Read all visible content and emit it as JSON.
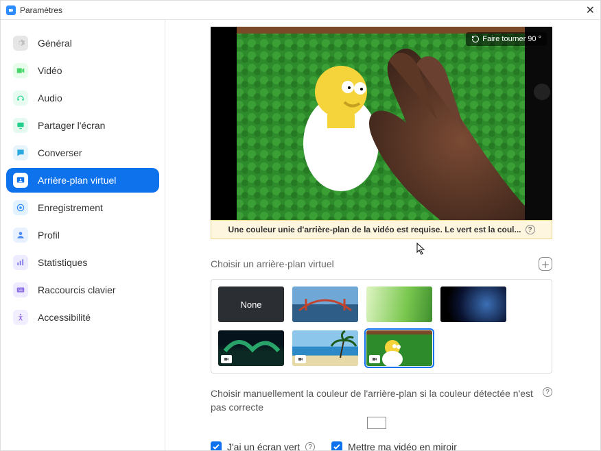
{
  "window": {
    "title": "Paramètres"
  },
  "sidebar": {
    "items": [
      {
        "label": "Général",
        "icon": "gear-icon",
        "bg": "#E6E6E6",
        "fg": "#bfbfbf"
      },
      {
        "label": "Vidéo",
        "icon": "camera-icon",
        "bg": "#E8FCEB",
        "fg": "#47D66A"
      },
      {
        "label": "Audio",
        "icon": "headphones-icon",
        "bg": "#E7FBF1",
        "fg": "#24D390"
      },
      {
        "label": "Partager l'écran",
        "icon": "share-icon",
        "bg": "#E5F9F1",
        "fg": "#23CE8D"
      },
      {
        "label": "Converser",
        "icon": "chat-icon",
        "bg": "#E8F4FC",
        "fg": "#2BA8E0"
      },
      {
        "label": "Arrière-plan virtuel",
        "icon": "background-icon",
        "bg": "#0E72ED",
        "fg": "#FFFFFF",
        "active": true
      },
      {
        "label": "Enregistrement",
        "icon": "record-icon",
        "bg": "#E3F2FF",
        "fg": "#2D8CFF"
      },
      {
        "label": "Profil",
        "icon": "person-icon",
        "bg": "#E7F1FF",
        "fg": "#4B8BF4"
      },
      {
        "label": "Statistiques",
        "icon": "chart-icon",
        "bg": "#ECEBFF",
        "fg": "#7B73E6"
      },
      {
        "label": "Raccourcis clavier",
        "icon": "keyboard-icon",
        "bg": "#EFEBFF",
        "fg": "#8C6FE6"
      },
      {
        "label": "Accessibilité",
        "icon": "accessibility-icon",
        "bg": "#F1EEFF",
        "fg": "#9A77E6"
      }
    ]
  },
  "preview": {
    "rotate_label": "Faire tourner 90 °",
    "warning": "Une couleur unie d'arrière-plan de la vidéo est requise. Le vert est la coul..."
  },
  "section": {
    "choose_label": "Choisir un arrière-plan virtuel",
    "none_label": "None",
    "manual_label": "Choisir manuellement la couleur de l'arrière-plan si la couleur détectée n'est pas correcte",
    "green_screen": "J'ai un écran vert",
    "mirror_video": "Mettre ma vidéo en miroir"
  },
  "colors": {
    "accent": "#0E72ED"
  }
}
